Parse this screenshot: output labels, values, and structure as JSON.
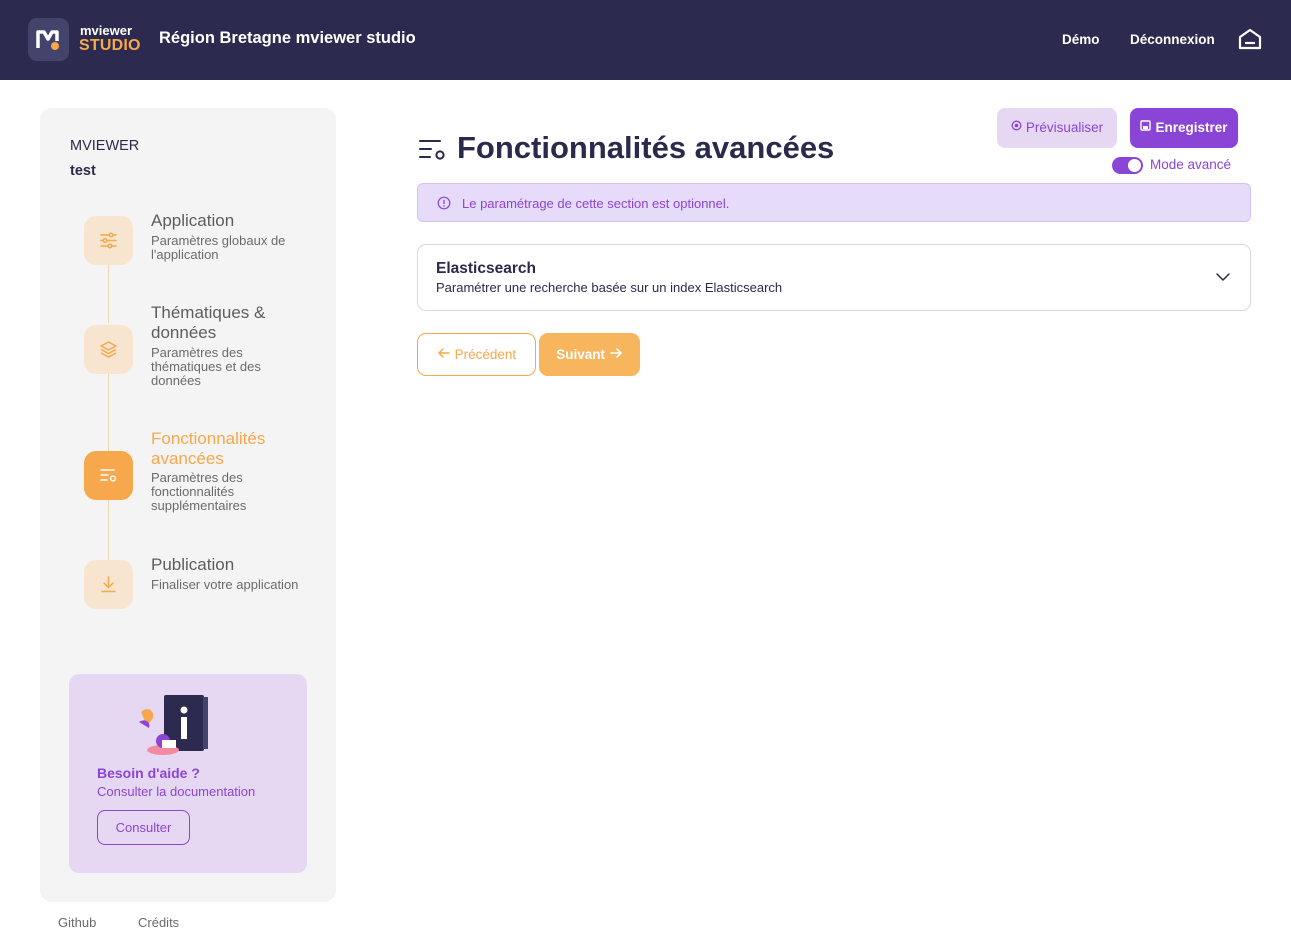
{
  "header": {
    "logo_line1": "mviewer",
    "logo_line2": "STUDIO",
    "app_title": "Région Bretagne mviewer studio",
    "nav": {
      "demo": "Démo",
      "logout": "Déconnexion"
    }
  },
  "sidebar": {
    "project_label": "MVIEWER",
    "project_name": "test",
    "steps": [
      {
        "title": "Application",
        "desc": "Paramètres globaux de l'application",
        "icon": "sliders-icon",
        "active": false
      },
      {
        "title": "Thématiques & données",
        "desc": "Paramètres des thématiques et des données",
        "icon": "layers-icon",
        "active": false
      },
      {
        "title": "Fonctionnalités avancées",
        "desc": "Paramètres des fonctionnalités supplémentaires",
        "icon": "list-settings-icon",
        "active": true
      },
      {
        "title": "Publication",
        "desc": "Finaliser votre application",
        "icon": "download-icon",
        "active": false
      }
    ],
    "help": {
      "title": "Besoin d'aide ?",
      "subtitle": "Consulter la documentation",
      "button": "Consulter"
    }
  },
  "footer": {
    "github": "Github",
    "credits": "Crédits"
  },
  "main": {
    "title": "Fonctionnalités avancées",
    "preview_button": "Prévisualiser",
    "save_button": "Enregistrer",
    "advanced_mode_label": "Mode avancé",
    "advanced_mode_on": true,
    "alert": "Le paramétrage de cette section est optionnel.",
    "accordion": {
      "title": "Elasticsearch",
      "subtitle": "Paramétrer une recherche basée sur un index Elasticsearch"
    },
    "prev_button": "Précédent",
    "next_button": "Suivant"
  },
  "colors": {
    "header_bg": "#2c2b4f",
    "accent_orange": "#f7a74c",
    "accent_purple": "#8b45d6",
    "light_purple": "#e6d7f2"
  }
}
